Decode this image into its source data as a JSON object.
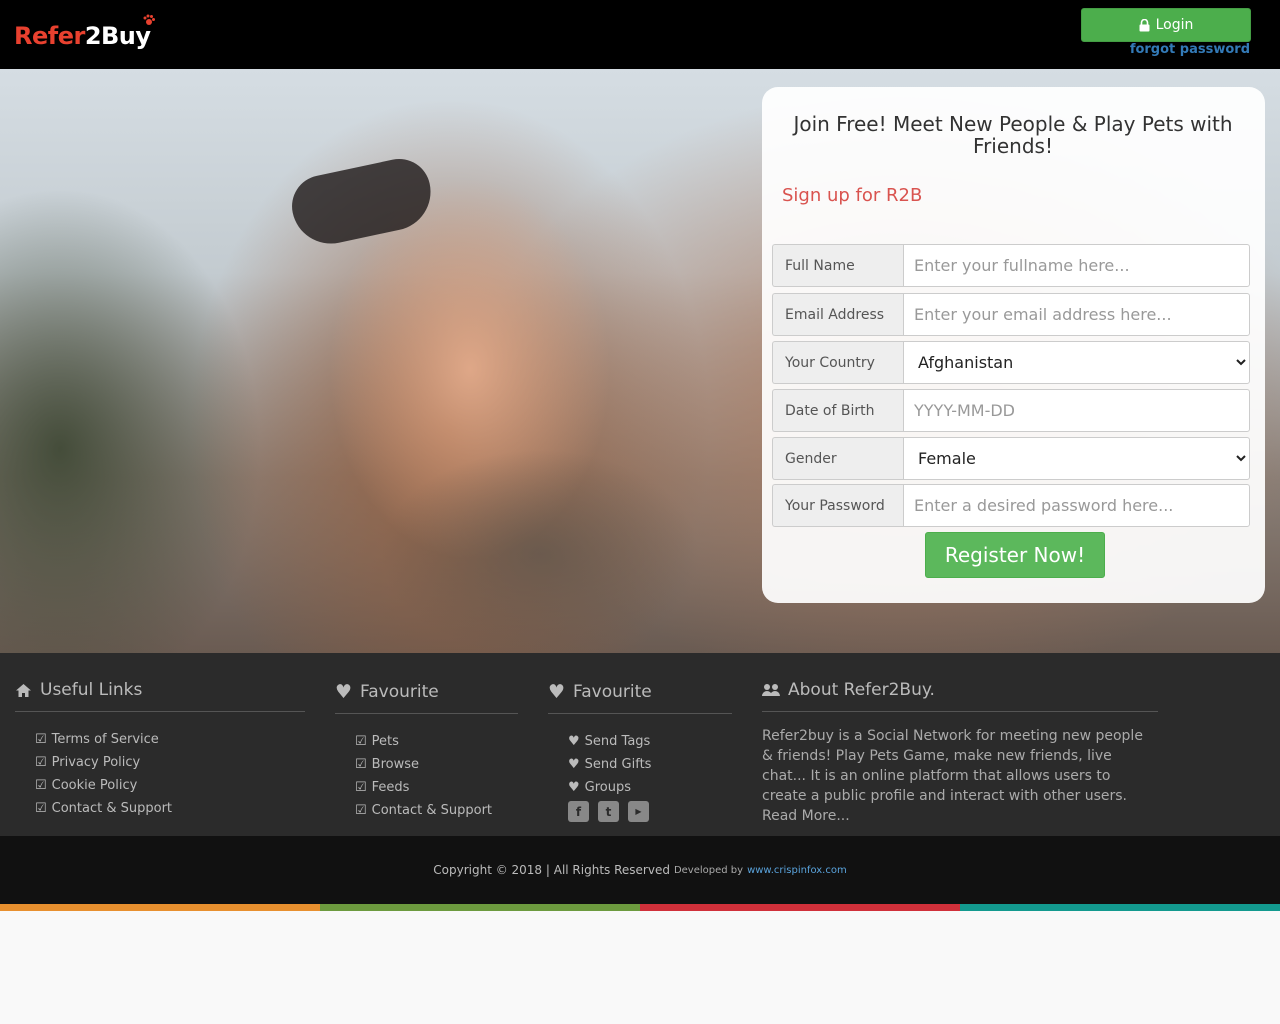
{
  "header": {
    "logo_refer": "Refer",
    "logo_two": "2",
    "logo_buy": "Buy",
    "login_label": "Login",
    "forgot_label": "forgot password"
  },
  "signup": {
    "title": "Join Free! Meet New People & Play Pets with Friends!",
    "subtitle": "Sign up for R2B",
    "fields": [
      {
        "label": "Full Name",
        "placeholder": "Enter your fullname here..."
      },
      {
        "label": "Email Address",
        "placeholder": "Enter your email address here..."
      },
      {
        "label": "Your Country",
        "value": "Afghanistan"
      },
      {
        "label": "Date of Birth",
        "placeholder": "YYYY-MM-DD"
      },
      {
        "label": "Gender",
        "value": "Female"
      },
      {
        "label": "Your Password",
        "placeholder": "Enter a desired password here..."
      }
    ],
    "register_label": "Register Now!"
  },
  "footer": {
    "useful": {
      "title": "Useful Links",
      "items": [
        "Terms of Service",
        "Privacy Policy",
        "Cookie Policy",
        "Contact & Support"
      ]
    },
    "fav1": {
      "title": "Favourite",
      "items": [
        "Pets",
        "Browse",
        "Feeds",
        "Contact & Support"
      ]
    },
    "fav2": {
      "title": "Favourite",
      "items": [
        "Send Tags",
        "Send Gifts",
        "Groups"
      ]
    },
    "about": {
      "title": "About Refer2Buy.",
      "text": "Refer2buy is a Social Network for meeting new people & friends! Play Pets Game, make new friends, live chat... It is an online platform that allows users to create a public profile and interact with other users. Read More..."
    },
    "copyright": "Copyright © 2018 | All Rights Reserved",
    "developed_by": "Developed by",
    "developer_link": "www.crispinfox.com"
  },
  "colors": {
    "accent_green": "#5cb85c",
    "header_bg": "#000000",
    "footer_bg": "#2b2b2b",
    "stripe_orange": "#e8902f",
    "stripe_green": "#6d9b3f",
    "stripe_red": "#d0303a",
    "stripe_teal": "#139a8f"
  },
  "icons": {
    "login": "lock-icon",
    "useful": "home-icon",
    "favourite": "heart-icon",
    "about": "users-icon",
    "list": "check-square-icon",
    "social": [
      "facebook-icon",
      "twitter-icon",
      "youtube-icon"
    ]
  }
}
